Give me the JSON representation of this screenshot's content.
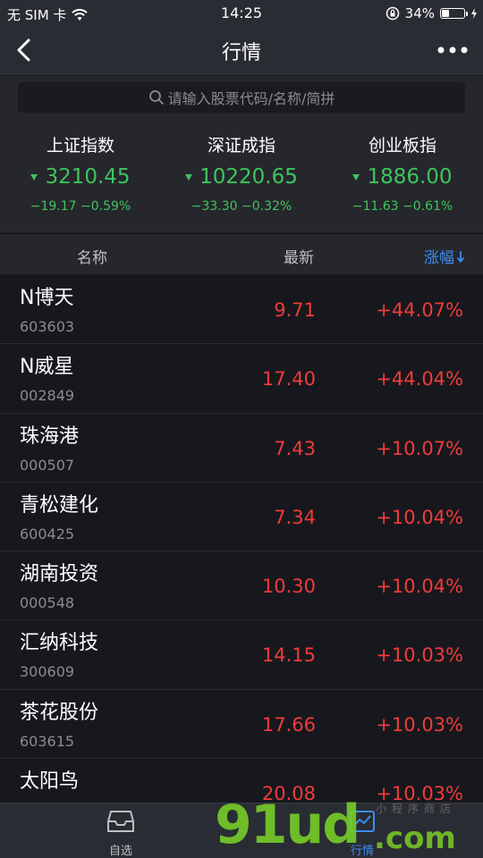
{
  "status_bar": {
    "carrier": "无 SIM 卡",
    "time": "14:25",
    "battery": "34%",
    "battery_level": 0.34
  },
  "nav": {
    "title": "行情"
  },
  "search": {
    "placeholder": "请输入股票代码/名称/简拼"
  },
  "indices": [
    {
      "name": "上证指数",
      "value": "3210.45",
      "change": "−19.17  −0.59%"
    },
    {
      "name": "深证成指",
      "value": "10220.65",
      "change": "−33.30  −0.32%"
    },
    {
      "name": "创业板指",
      "value": "1886.00",
      "change": "−11.63  −0.61%"
    }
  ],
  "table": {
    "col_name": "名称",
    "col_latest": "最新",
    "col_change": "涨幅",
    "rows": [
      {
        "name": "N博天",
        "code": "603603",
        "price": "9.71",
        "change": "+44.07%"
      },
      {
        "name": "N威星",
        "code": "002849",
        "price": "17.40",
        "change": "+44.04%"
      },
      {
        "name": "珠海港",
        "code": "000507",
        "price": "7.43",
        "change": "+10.07%"
      },
      {
        "name": "青松建化",
        "code": "600425",
        "price": "7.34",
        "change": "+10.04%"
      },
      {
        "name": "湖南投资",
        "code": "000548",
        "price": "10.30",
        "change": "+10.04%"
      },
      {
        "name": "汇纳科技",
        "code": "300609",
        "price": "14.15",
        "change": "+10.03%"
      },
      {
        "name": "茶花股份",
        "code": "603615",
        "price": "17.66",
        "change": "+10.03%"
      },
      {
        "name": "太阳鸟",
        "code": "",
        "price": "20.08",
        "change": "+10.03%"
      }
    ]
  },
  "tabs": [
    {
      "label": "自选",
      "icon": "inbox-icon"
    },
    {
      "label": "行情",
      "icon": "chart-icon"
    }
  ],
  "watermark": {
    "main": "91ud",
    "suffix": ".com",
    "small": "小程序商店"
  },
  "colors": {
    "up": "#ef3b3b",
    "down": "#3fc45c",
    "accent": "#3d8df0"
  }
}
